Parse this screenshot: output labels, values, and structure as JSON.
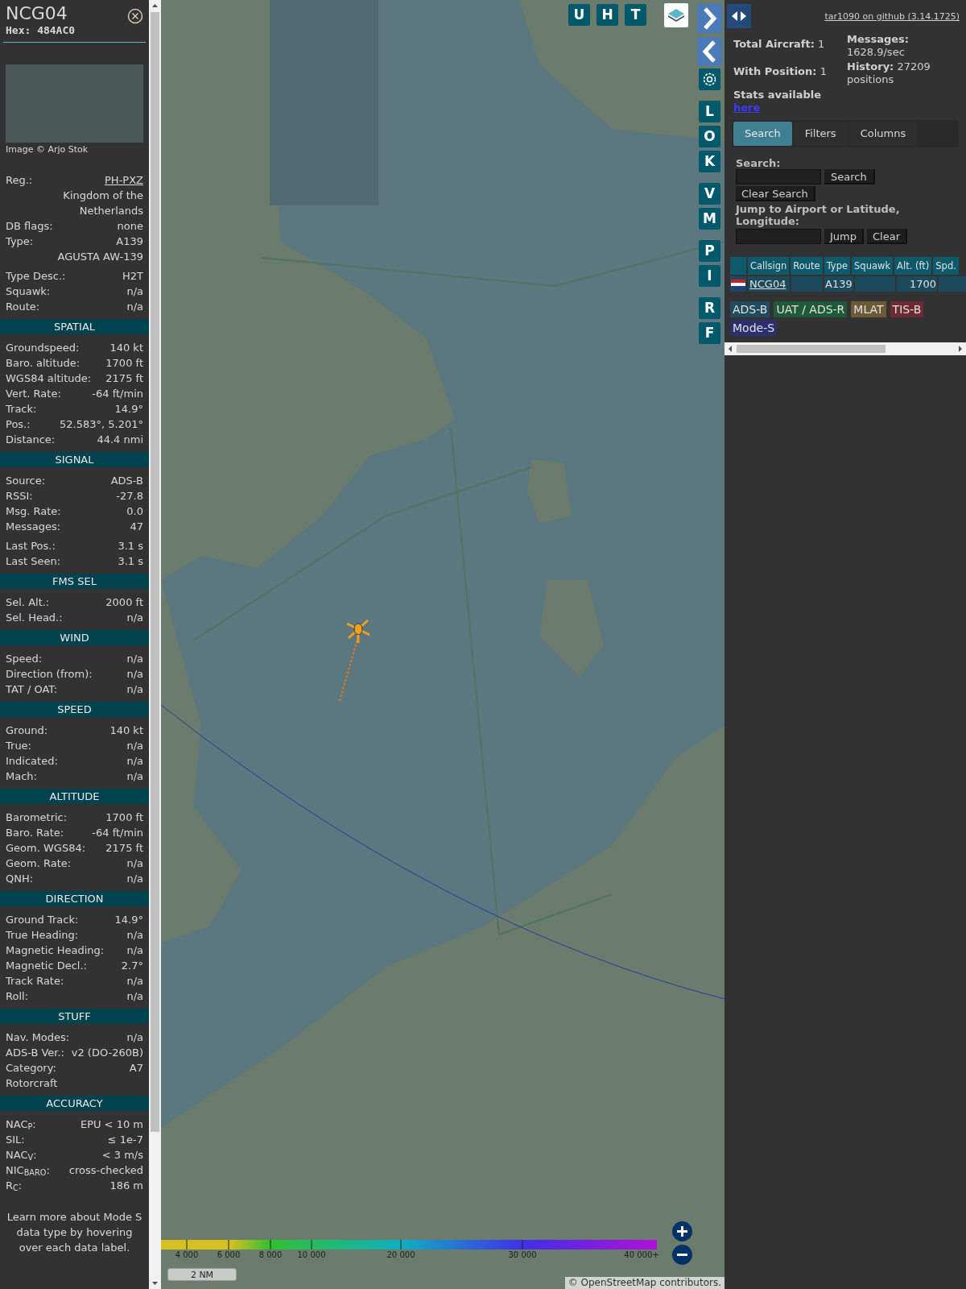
{
  "aircraft": {
    "callsign": "NCG04",
    "hex": "Hex: 484AC0",
    "image_credit": "Image © Arjo Stok"
  },
  "summary": [
    [
      {
        "kind": "link",
        "label": "Reg.:",
        "value": "PH-PXZ"
      },
      {
        "kind": "value",
        "value": "Kingdom of the Netherlands"
      },
      {
        "kind": "pair",
        "label": "DB flags:",
        "value": "none"
      },
      {
        "kind": "pair",
        "label": "Type:",
        "value": "A139"
      },
      {
        "kind": "value",
        "value": "AGUSTA AW-139"
      }
    ],
    [
      {
        "kind": "pair",
        "label": "Type Desc.:",
        "value": "H2T"
      },
      {
        "kind": "pair",
        "label": "Squawk:",
        "value": "n/a"
      },
      {
        "kind": "pair",
        "label": "Route:",
        "value": "n/a"
      }
    ]
  ],
  "sections": [
    {
      "title": "SPATIAL",
      "groups": [
        [
          {
            "kind": "pair",
            "label": "Groundspeed:",
            "value": "140 kt"
          },
          {
            "kind": "pair",
            "label": "Baro. altitude:",
            "value": "1700 ft"
          },
          {
            "kind": "pair",
            "label": "WGS84 altitude:",
            "value": "2175 ft"
          },
          {
            "kind": "pair",
            "label": "Vert. Rate:",
            "value": "-64 ft/min"
          },
          {
            "kind": "pair",
            "label": "Track:",
            "value": "14.9°"
          },
          {
            "kind": "pair",
            "label": "Pos.:",
            "value": "52.583°, 5.201°"
          },
          {
            "kind": "pair",
            "label": "Distance:",
            "value": "44.4 nmi"
          }
        ]
      ]
    },
    {
      "title": "SIGNAL",
      "groups": [
        [
          {
            "kind": "pair",
            "label": "Source:",
            "value": "ADS-B"
          },
          {
            "kind": "pair",
            "label": "RSSI:",
            "value": "-27.8"
          },
          {
            "kind": "pair",
            "label": "Msg. Rate:",
            "value": "0.0"
          },
          {
            "kind": "pair",
            "label": "Messages:",
            "value": "47"
          }
        ],
        [
          {
            "kind": "pair",
            "label": "Last Pos.:",
            "value": "3.1 s"
          },
          {
            "kind": "pair",
            "label": "Last Seen:",
            "value": "3.1 s"
          }
        ]
      ]
    },
    {
      "title": "FMS SEL",
      "groups": [
        [
          {
            "kind": "pair",
            "label": "Sel. Alt.:",
            "value": "2000 ft"
          },
          {
            "kind": "pair",
            "label": "Sel. Head.:",
            "value": "n/a"
          }
        ]
      ]
    },
    {
      "title": "WIND",
      "groups": [
        [
          {
            "kind": "pair",
            "label": "Speed:",
            "value": "n/a"
          },
          {
            "kind": "pair",
            "label": "Direction (from):",
            "value": "n/a"
          },
          {
            "kind": "pair",
            "label": "TAT / OAT:",
            "value": "n/a"
          }
        ]
      ]
    },
    {
      "title": "SPEED",
      "groups": [
        [
          {
            "kind": "pair",
            "label": "Ground:",
            "value": "140 kt"
          },
          {
            "kind": "pair",
            "label": "True:",
            "value": "n/a"
          },
          {
            "kind": "pair",
            "label": "Indicated:",
            "value": "n/a"
          },
          {
            "kind": "pair",
            "label": "Mach:",
            "value": "n/a"
          }
        ]
      ]
    },
    {
      "title": "ALTITUDE",
      "groups": [
        [
          {
            "kind": "pair",
            "label": "Barometric:",
            "value": "1700 ft"
          },
          {
            "kind": "pair",
            "label": "Baro. Rate:",
            "value": "-64 ft/min"
          },
          {
            "kind": "pair",
            "label": "Geom. WGS84:",
            "value": "2175 ft"
          },
          {
            "kind": "pair",
            "label": "Geom. Rate:",
            "value": "n/a"
          },
          {
            "kind": "pair",
            "label": "QNH:",
            "value": "n/a"
          }
        ]
      ]
    },
    {
      "title": "DIRECTION",
      "groups": [
        [
          {
            "kind": "pair",
            "label": "Ground Track:",
            "value": "14.9°"
          },
          {
            "kind": "pair",
            "label": "True Heading:",
            "value": "n/a"
          },
          {
            "kind": "pair",
            "label": "Magnetic Heading:",
            "value": "n/a"
          },
          {
            "kind": "pair",
            "label": "Magnetic Decl.:",
            "value": "2.7°"
          },
          {
            "kind": "pair",
            "label": "Track Rate:",
            "value": "n/a"
          },
          {
            "kind": "pair",
            "label": "Roll:",
            "value": "n/a"
          }
        ]
      ]
    },
    {
      "title": "STUFF",
      "groups": [
        [
          {
            "kind": "pair",
            "label": "Nav. Modes:",
            "value": "n/a"
          },
          {
            "kind": "pair",
            "label": "ADS-B Ver.:",
            "value": "v2 (DO-260B)"
          },
          {
            "kind": "pair",
            "label": "Category:",
            "value": "A7"
          },
          {
            "kind": "label",
            "label": "Rotorcraft"
          }
        ]
      ]
    },
    {
      "title": "ACCURACY",
      "groups": [
        [
          {
            "kind": "pair",
            "label": "NAC$_{P}$:",
            "value": "EPU < 10 m"
          },
          {
            "kind": "pair",
            "label": "SIL:",
            "value": "≤ 1e-7"
          },
          {
            "kind": "pair",
            "label": "NAC$_{V}$:",
            "value": "< 3 m/s"
          },
          {
            "kind": "pair",
            "label": "NIC$_{BARO}$:",
            "value": "cross-checked"
          },
          {
            "kind": "pair",
            "label": "R$_{C}$:",
            "value": "186 m"
          }
        ]
      ]
    }
  ],
  "note": "Learn more about Mode S data type by hovering over each data label.",
  "map": {
    "top_buttons": [
      "U",
      "H",
      "T"
    ],
    "side_buttons": [
      [
        "L",
        "O",
        "K"
      ],
      [
        "V",
        "M"
      ],
      [
        "P",
        "I"
      ],
      [
        "R",
        "F"
      ]
    ],
    "altitude_scale": [
      "4 000",
      "6 000",
      "8 000",
      "10 000",
      "20 000",
      "30 000",
      "40 000+"
    ],
    "scale_bar": "2 NM",
    "attribution": "© OpenStreetMap contributors."
  },
  "panel": {
    "github_link": "tar1090 on github (3.14.1725)",
    "stats_left": [
      {
        "label": "Total Aircraft:",
        "value": "1"
      },
      {
        "label": "With Position:",
        "value": "1"
      }
    ],
    "stats_right": [
      {
        "label": "Messages:",
        "value": "1628.9/sec"
      },
      {
        "label": "History:",
        "value": "27209 positions"
      }
    ],
    "stats_text": "Stats available",
    "stats_link": "here",
    "tabs": [
      {
        "label": "Search",
        "selected": true
      },
      {
        "label": "Filters",
        "selected": false
      },
      {
        "label": "Columns",
        "selected": false
      }
    ],
    "search": {
      "label": "Search:",
      "button": "Search",
      "clear_button": "Clear Search"
    },
    "jump": {
      "label": "Jump to Airport or Latitude, Longitude:",
      "buttons": [
        "Jump",
        "Clear"
      ]
    },
    "table": {
      "columns": [
        "Callsign",
        "Route",
        "Type",
        "Squawk",
        "Alt. (ft)",
        "Spd."
      ],
      "rows": [
        {
          "selected": true,
          "callsign": "NCG04",
          "type": "A139",
          "altitude": "1700"
        }
      ]
    },
    "legend": [
      {
        "label": "ADS-B",
        "color": "#1f4b5c"
      },
      {
        "label": "UAT / ADS-R",
        "color": "#1e5a38"
      },
      {
        "label": "MLAT",
        "color": "#6b5a36"
      },
      {
        "label": "TIS-B",
        "color": "#6e2a32"
      },
      {
        "label": "Mode-S",
        "color": "#2c2f6e"
      }
    ]
  }
}
